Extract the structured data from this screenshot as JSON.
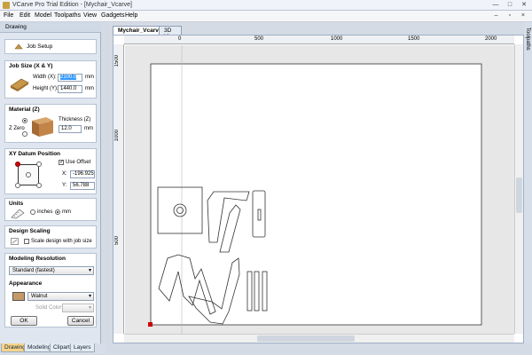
{
  "window": {
    "title": "VCarve Pro Trial Edition - [Mychair_Vcarve]",
    "minimize": "—",
    "maximize": "□",
    "close": "✕"
  },
  "menu": [
    "File",
    "Edit",
    "Model",
    "Toolpaths",
    "View",
    "Gadgets",
    "Help"
  ],
  "mdi_controls": "– ▫ ×",
  "panel": {
    "header": "Drawing",
    "job_setup": "Job Setup",
    "job_size": {
      "title": "Job Size (X & Y)",
      "width_label": "Width (X):",
      "width_value": "2100.0",
      "height_label": "Height (Y):",
      "height_value": "1440.0",
      "unit": "mm"
    },
    "material": {
      "title": "Material (Z)",
      "thickness_label": "Thickness (Z)",
      "thickness_value": "12.0",
      "unit": "mm",
      "zzero_label": "Z Zero"
    },
    "datum": {
      "title": "XY Datum Position",
      "use_offset": "Use Offset",
      "x_label": "X:",
      "x_value": "-196.925",
      "y_label": "Y:",
      "y_value": "56.788"
    },
    "units": {
      "title": "Units",
      "inches": "inches",
      "mm": "mm"
    },
    "scaling": {
      "title": "Design Scaling",
      "checkbox": "Scale design with job size"
    },
    "modeling": {
      "title": "Modeling Resolution",
      "value": "Standard (fastest)"
    },
    "appearance": {
      "title": "Appearance",
      "material": "Walnut",
      "solid_color": "Solid Color:"
    },
    "ok": "OK",
    "cancel": "Cancel"
  },
  "bottom_tabs": [
    "Drawing",
    "Modeling",
    "Clipart",
    "Layers"
  ],
  "doc_tabs": [
    "Mychair_Vcarve",
    "3D View"
  ],
  "ruler_top": [
    "0",
    "500",
    "1000",
    "1500",
    "2000"
  ],
  "ruler_left": [
    "1500",
    "1000",
    "500"
  ],
  "toolpaths_tab": "Toolpaths",
  "colors": {
    "selected_text_bg": "#3399ff",
    "active_tab": "#f8d48c",
    "origin_marker": "#cc0000"
  }
}
